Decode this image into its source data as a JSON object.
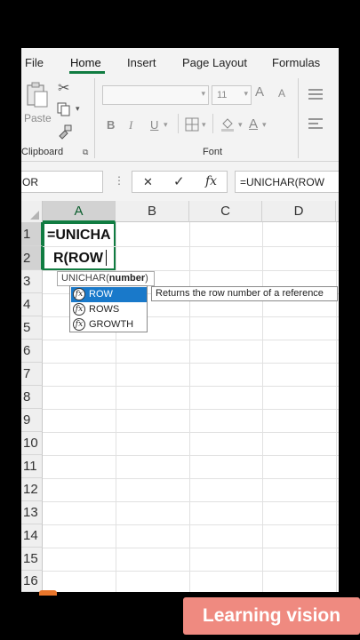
{
  "ribbon_tabs": [
    "File",
    "Home",
    "Insert",
    "Page Layout",
    "Formulas"
  ],
  "ribbon": {
    "paste_label": "Paste",
    "clipboard_group": "Clipboard",
    "font_group": "Font",
    "font_size": "11",
    "grow_font": "A",
    "shrink_font": "A",
    "bold": "B",
    "italic": "I",
    "underline": "U"
  },
  "formula_bar": {
    "name_box": "OR",
    "cancel_symbol": "✕",
    "enter_symbol": "✓",
    "fx_symbol": "fx",
    "content": "=UNICHAR(ROW"
  },
  "sheet": {
    "columns": [
      "A",
      "B",
      "C",
      "D"
    ],
    "rows": [
      "1",
      "2",
      "3",
      "4",
      "5",
      "6",
      "7",
      "8",
      "9",
      "10",
      "11",
      "12",
      "13",
      "14",
      "15",
      "16"
    ],
    "active_cell_line1": "=UNICHA",
    "active_cell_line2": "R(ROW"
  },
  "tooltip": {
    "function": "UNICHAR(",
    "argument": "number",
    "close": ")"
  },
  "autocomplete": {
    "items": [
      "ROW",
      "ROWS",
      "GROWTH"
    ],
    "selected_index": 0,
    "description": "Returns the row number of a reference"
  },
  "badge": "Learning vision",
  "colors": {
    "excel_green": "#107c41",
    "selection_blue": "#1979ca",
    "badge": "#ef8a80"
  }
}
